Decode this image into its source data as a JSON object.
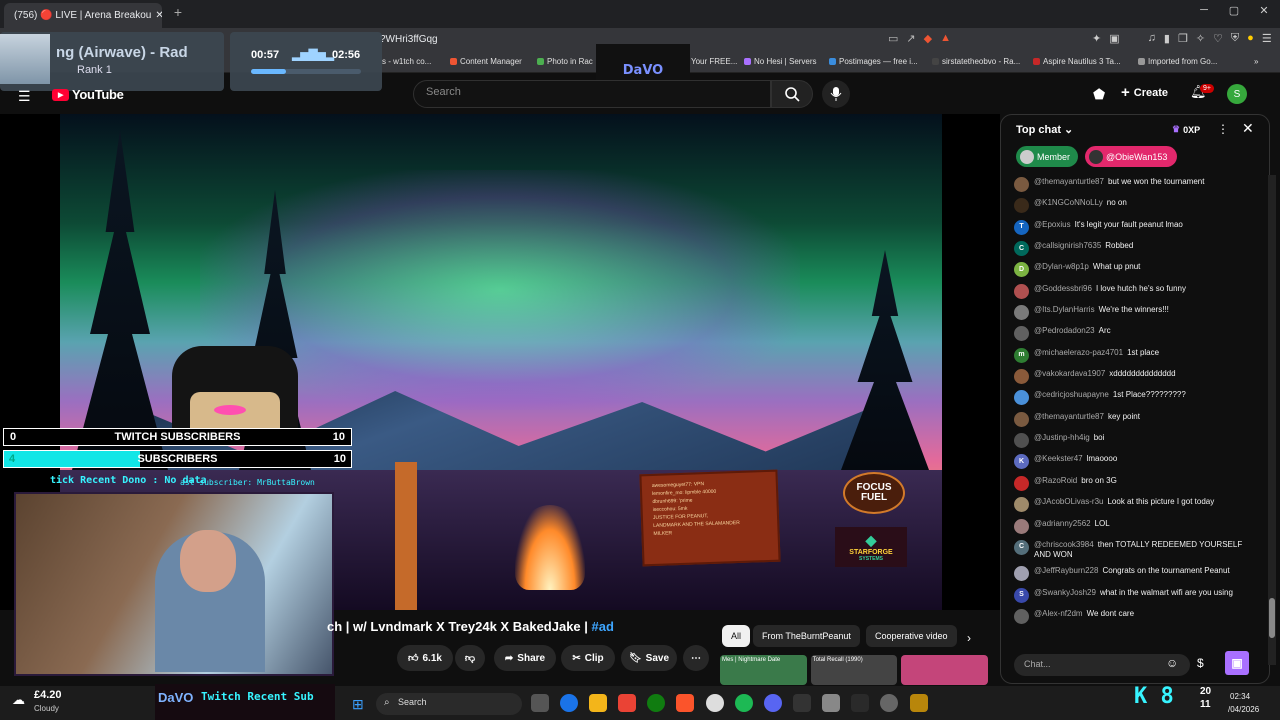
{
  "browser": {
    "tab_title": "(756) 🔴 LIVE | Arena Breakou",
    "url": "?WHri3ffGqg",
    "bookmarks": [
      "s - w1tch co...",
      "Content Manager",
      "Photo in Rac",
      "Your FREE...",
      "No Hesi | Servers",
      "Postimages — free i...",
      "sirstatetheobvo - Ra...",
      "Aspire Nautilus 3 Ta...",
      "Imported from Go..."
    ]
  },
  "music": {
    "title": "ng (Airwave) - Rad",
    "subtitle": "Rank 1",
    "time_start": "00:57",
    "time_end": "02:56",
    "progress": 0.32
  },
  "stream_logo": "DaVO",
  "youtube": {
    "logo": "YouTube",
    "search_placeholder": "Search",
    "create_label": "Create",
    "notif_badge": "9+",
    "avatar_letter": "S"
  },
  "overlay": {
    "sub1_left": "0",
    "sub1_label": "TWITCH SUBSCRIBERS",
    "sub1_right": "10",
    "sub2_left": "4",
    "sub2_label": "SUBSCRIBERS",
    "sub2_right": "10",
    "recent_dono": "tick Recent Dono : No data",
    "last_sub": "ast subscriber: MrButtaBrown",
    "focus_fuel": "FOCUS FUEL",
    "starforge": "STARFORGE",
    "starforge_sub": "SYSTEMS",
    "sign_lines": [
      "awesomeguyet77: VPN",
      "lemonfire_mo: lipmble 40000",
      "dbrunh699: 'prime",
      "iseccohou: 5mk",
      "JUSTICE FOR PEANUT,",
      "LANDMARK AND THE SALAMANDER",
      "MILKER"
    ]
  },
  "video": {
    "title": "ch | w/ Lvndmark X Trey24k X BakedJake |",
    "hashtag": "#ad",
    "likes": "6.1k",
    "share": "Share",
    "clip": "Clip",
    "save": "Save",
    "chips": [
      "All",
      "From TheBurntPeanut",
      "Cooperative video"
    ],
    "thumbs": [
      "Mes | Nightmare Date",
      "Total Recall (1990)",
      ""
    ]
  },
  "chat": {
    "header": "Top chat",
    "oxp": "0XP",
    "member_label": "Member",
    "user_label": "@ObieWan153",
    "input_placeholder": "Chat...",
    "messages": [
      {
        "author": "@themayanturtle87",
        "text": "but we won the tournament",
        "color": "#7a5a40",
        "letter": ""
      },
      {
        "author": "@K1NGCoNNoLLy",
        "text": "no on",
        "color": "#3a2a1a",
        "letter": ""
      },
      {
        "author": "@Epoxius",
        "text": "It's legit your fault peanut lmao",
        "color": "#1565c0",
        "letter": "T"
      },
      {
        "author": "@callsignirish7635",
        "text": "Robbed",
        "color": "#00695c",
        "letter": "C"
      },
      {
        "author": "@Dylan-w8p1p",
        "text": "What up pnut",
        "color": "#7cb342",
        "letter": "D"
      },
      {
        "author": "@Goddessbri96",
        "text": "I love hutch he's so funny",
        "color": "#b05050",
        "letter": ""
      },
      {
        "author": "@Its.DylanHarris",
        "text": "We're the winners!!!",
        "color": "#7a7a7a",
        "letter": ""
      },
      {
        "author": "@Pedrodadon23",
        "text": "Arc",
        "color": "#606060",
        "letter": ""
      },
      {
        "author": "@michaelerazo-paz4701",
        "text": "1st place",
        "color": "#2e7d32",
        "letter": "m"
      },
      {
        "author": "@vakokardava1907",
        "text": "xdddddddddddddd",
        "color": "#8a5a3a",
        "letter": ""
      },
      {
        "author": "@cedricjoshuapayne",
        "text": "1st Place?????????",
        "color": "#4a90d9",
        "letter": ""
      },
      {
        "author": "@themayanturtle87",
        "text": "key point",
        "color": "#7a5a40",
        "letter": ""
      },
      {
        "author": "@Justinp-hh4ig",
        "text": "boi",
        "color": "#505050",
        "letter": ""
      },
      {
        "author": "@Keekster47",
        "text": "lmaoooo",
        "color": "#5c6bc0",
        "letter": "K"
      },
      {
        "author": "@RazoRoid",
        "text": "bro on 3G",
        "color": "#c62828",
        "letter": ""
      },
      {
        "author": "@JAcobOLivas-r3u",
        "text": "Look at this picture I got today",
        "color": "#9e8a6a",
        "letter": ""
      },
      {
        "author": "@adrianny2562",
        "text": "LOL",
        "color": "#9a7a7a",
        "letter": ""
      },
      {
        "author": "@chriscook3984",
        "text": "then TOTALLY REDEEMED YOURSELF AND WON",
        "color": "#546e7a",
        "letter": "C"
      },
      {
        "author": "@JeffRayburn228",
        "text": "Congrats on the tournament Peanut",
        "color": "#a0a0b0",
        "letter": ""
      },
      {
        "author": "@SwankyJosh29",
        "text": "what in the walmart wifi are you using",
        "color": "#3949ab",
        "letter": "S"
      },
      {
        "author": "@Alex-nf2dm",
        "text": "We dont care",
        "color": "#606060",
        "letter": ""
      }
    ]
  },
  "taskbar": {
    "temp": "£4.20",
    "condition": "Cloudy",
    "twitch_stub": "Twitch Recent Sub",
    "search": "Search",
    "k8": "K 8",
    "twenty": "20",
    "eleven": "11",
    "time": "02:34",
    "date": "/04/2026"
  }
}
